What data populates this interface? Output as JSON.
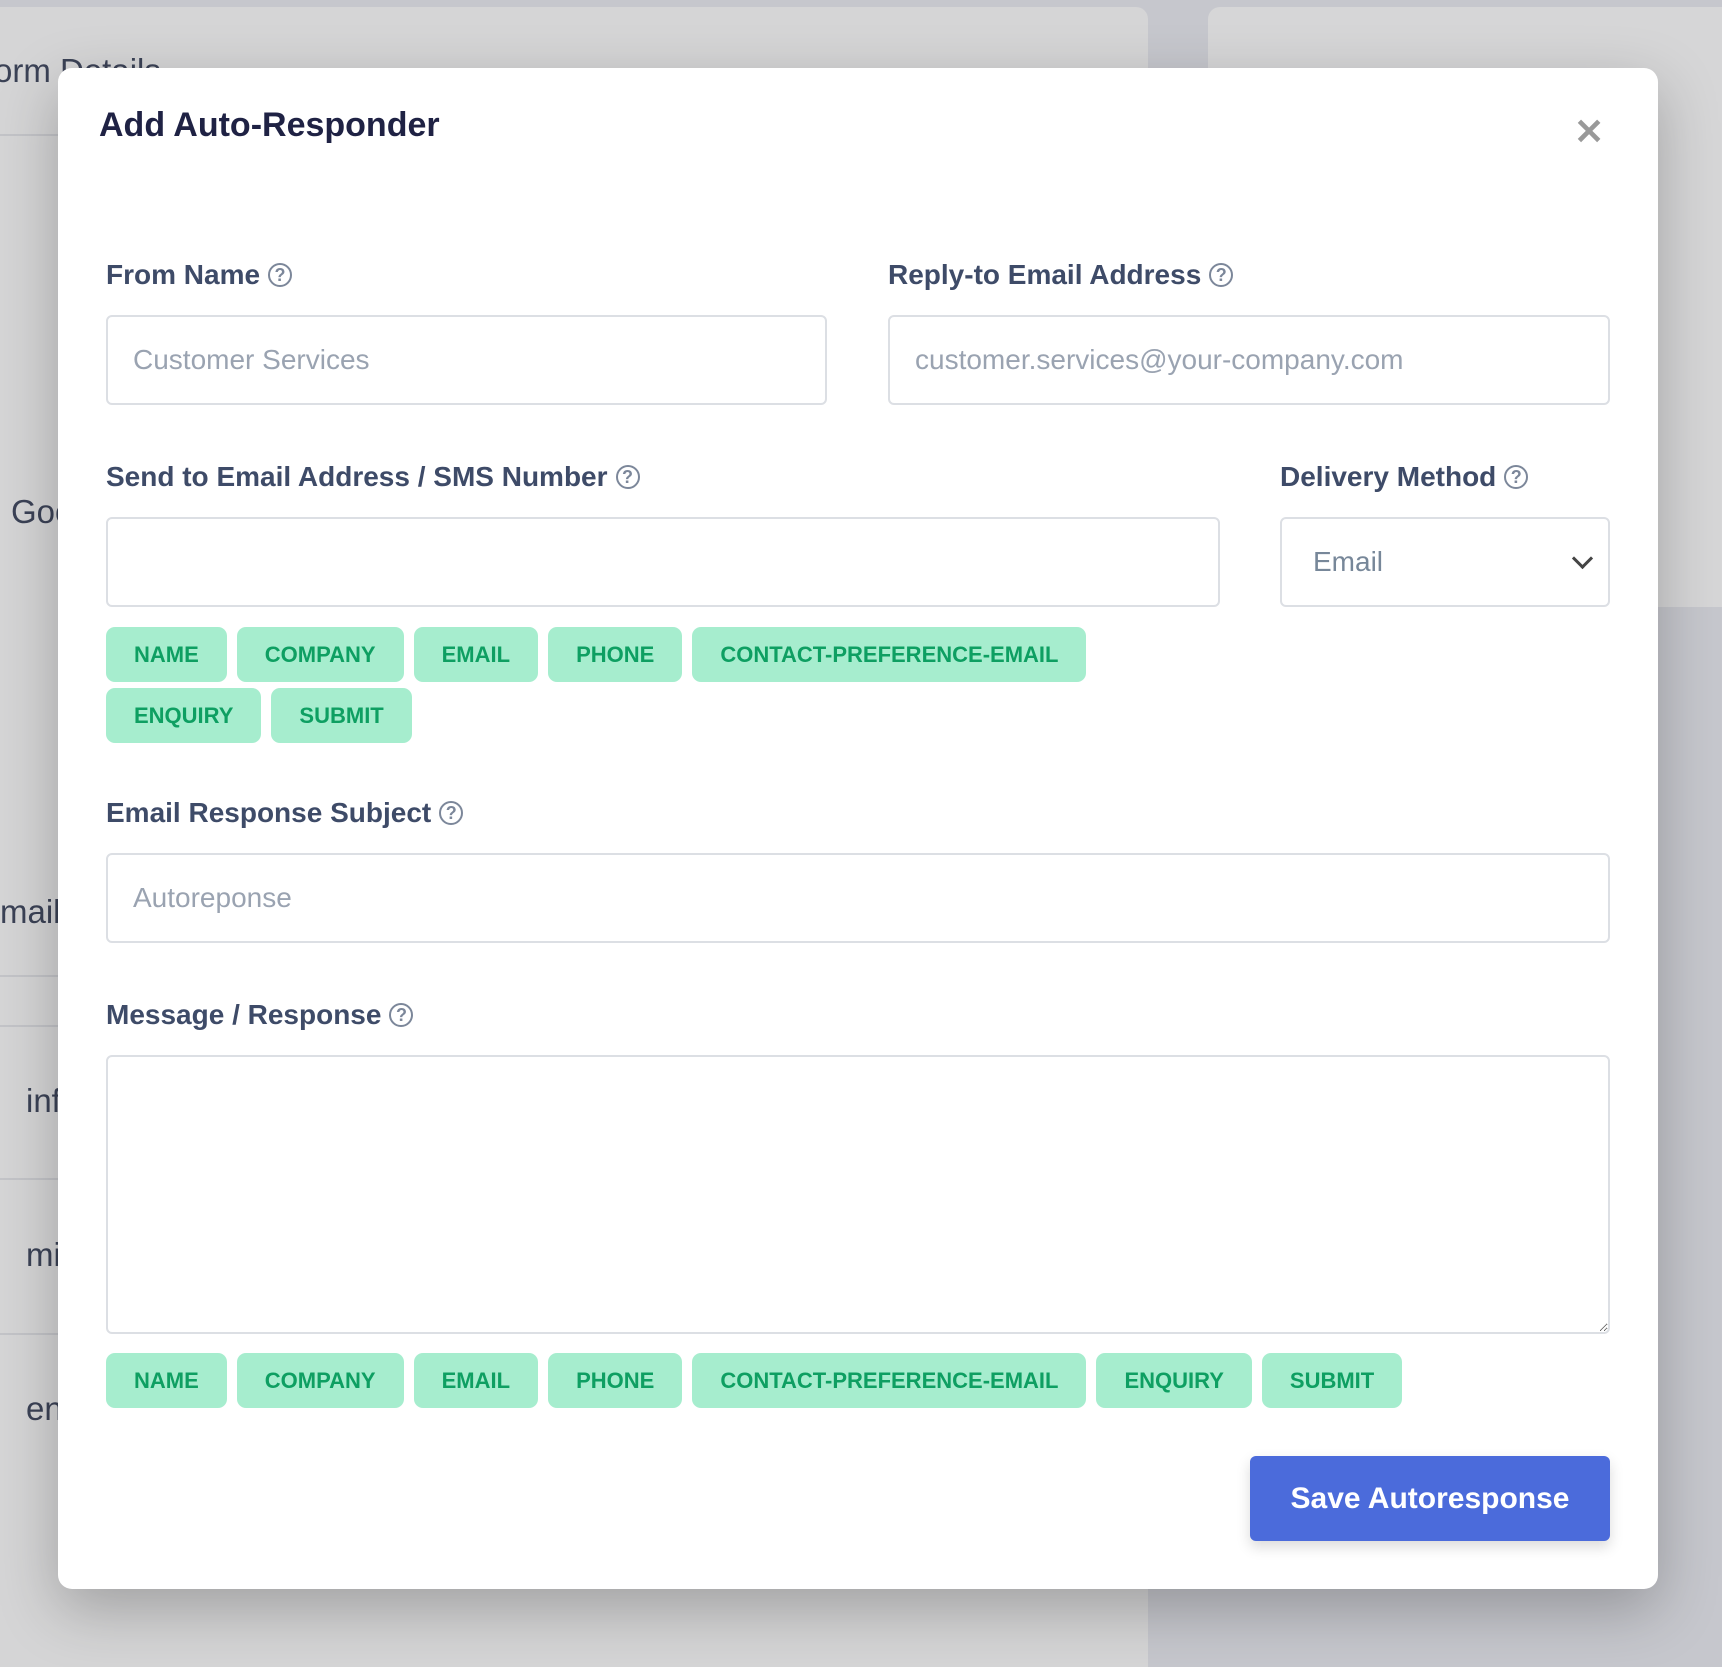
{
  "background": {
    "fragments": [
      "orm Details",
      "Goo",
      "mail",
      "inf",
      "mi",
      "en"
    ]
  },
  "modal": {
    "title": "Add Auto-Responder",
    "close_icon": "close-icon",
    "from_name": {
      "label": "From Name",
      "value": "",
      "placeholder": "Customer Services"
    },
    "reply_to": {
      "label": "Reply-to Email Address",
      "value": "",
      "placeholder": "customer.services@your-company.com"
    },
    "send_to": {
      "label": "Send to Email Address / SMS Number",
      "value": "",
      "placeholder": ""
    },
    "delivery_method": {
      "label": "Delivery Method",
      "selected": "Email"
    },
    "send_to_tags": [
      "NAME",
      "COMPANY",
      "EMAIL",
      "PHONE",
      "CONTACT-PREFERENCE-EMAIL",
      "ENQUIRY",
      "SUBMIT"
    ],
    "subject": {
      "label": "Email Response Subject",
      "value": "",
      "placeholder": "Autoreponse"
    },
    "message": {
      "label": "Message / Response",
      "value": "",
      "placeholder": ""
    },
    "message_tags": [
      "NAME",
      "COMPANY",
      "EMAIL",
      "PHONE",
      "CONTACT-PREFERENCE-EMAIL",
      "ENQUIRY",
      "SUBMIT"
    ],
    "save_label": "Save Autoresponse",
    "help_glyph": "?"
  },
  "colors": {
    "accent": "#4b6bdb",
    "tag_bg": "#a6edce",
    "tag_text": "#0e9f62",
    "label": "#3e4b68"
  }
}
